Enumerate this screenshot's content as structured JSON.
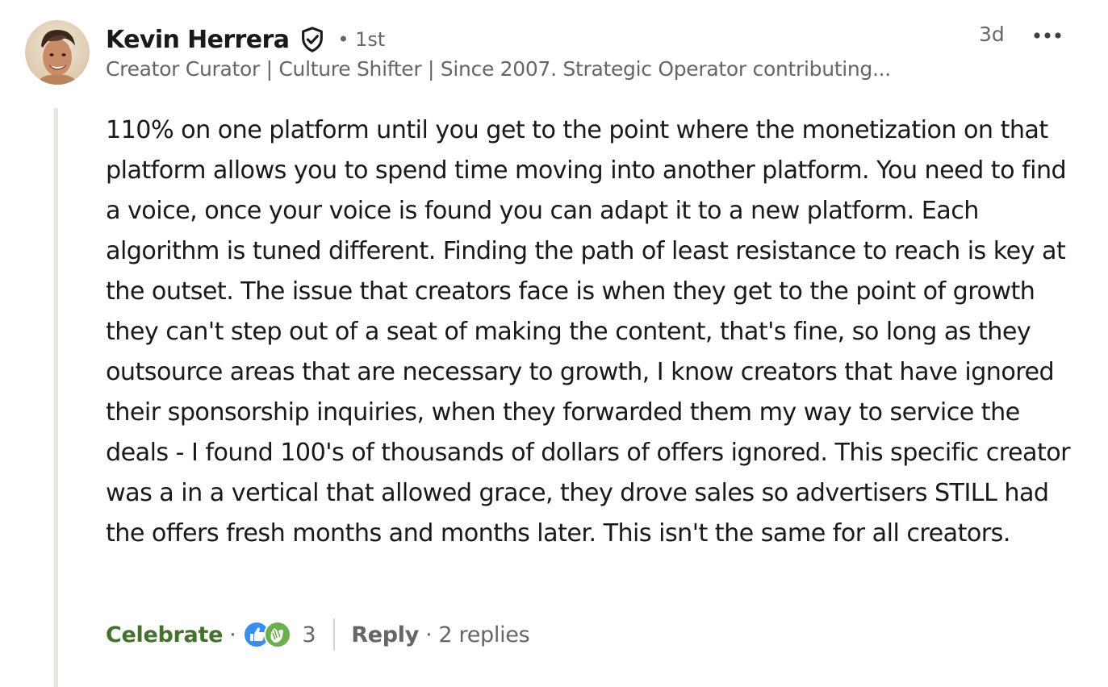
{
  "comment": {
    "author": {
      "name": "Kevin Herrera",
      "degree": "• 1st",
      "headline": "Creator Curator | Culture Shifter | Since 2007. Strategic Operator contributing..."
    },
    "timestamp": "3d",
    "body": "110% on one platform until you get to the point where the monetization on that platform allows you to spend time moving into another platform. You need to find a voice, once your voice is found you can adapt it to a new platform. Each algorithm is tuned different. Finding the path of least resistance to reach is key at the outset. The issue that creators face is when they get to the point of growth they can't step out of a seat of making the content, that's fine, so long as they outsource areas that are necessary to growth, I know creators that have ignored their sponsorship inquiries, when they forwarded them my way to service the deals - I found 100's of thousands of dollars of offers ignored. This specific creator was a in a vertical that allowed grace, they drove sales so advertisers STILL had the offers fresh months and months later. This isn't the same for all creators.",
    "actions": {
      "reaction_label": "Celebrate",
      "separator": "·",
      "reaction_icons": [
        "like-icon",
        "celebrate-icon"
      ],
      "reaction_count": "3",
      "reply_label": "Reply",
      "replies": "2 replies"
    }
  },
  "icons": {
    "verified": "shield-check-icon",
    "more": "ellipsis-icon"
  },
  "colors": {
    "text_primary": "#191919",
    "text_secondary": "#666666",
    "celebrate_green": "#44712e",
    "like_blue": "#378fe9",
    "celebrate_icon_green": "#6dae4f",
    "thread_line": "#e8e6df"
  }
}
